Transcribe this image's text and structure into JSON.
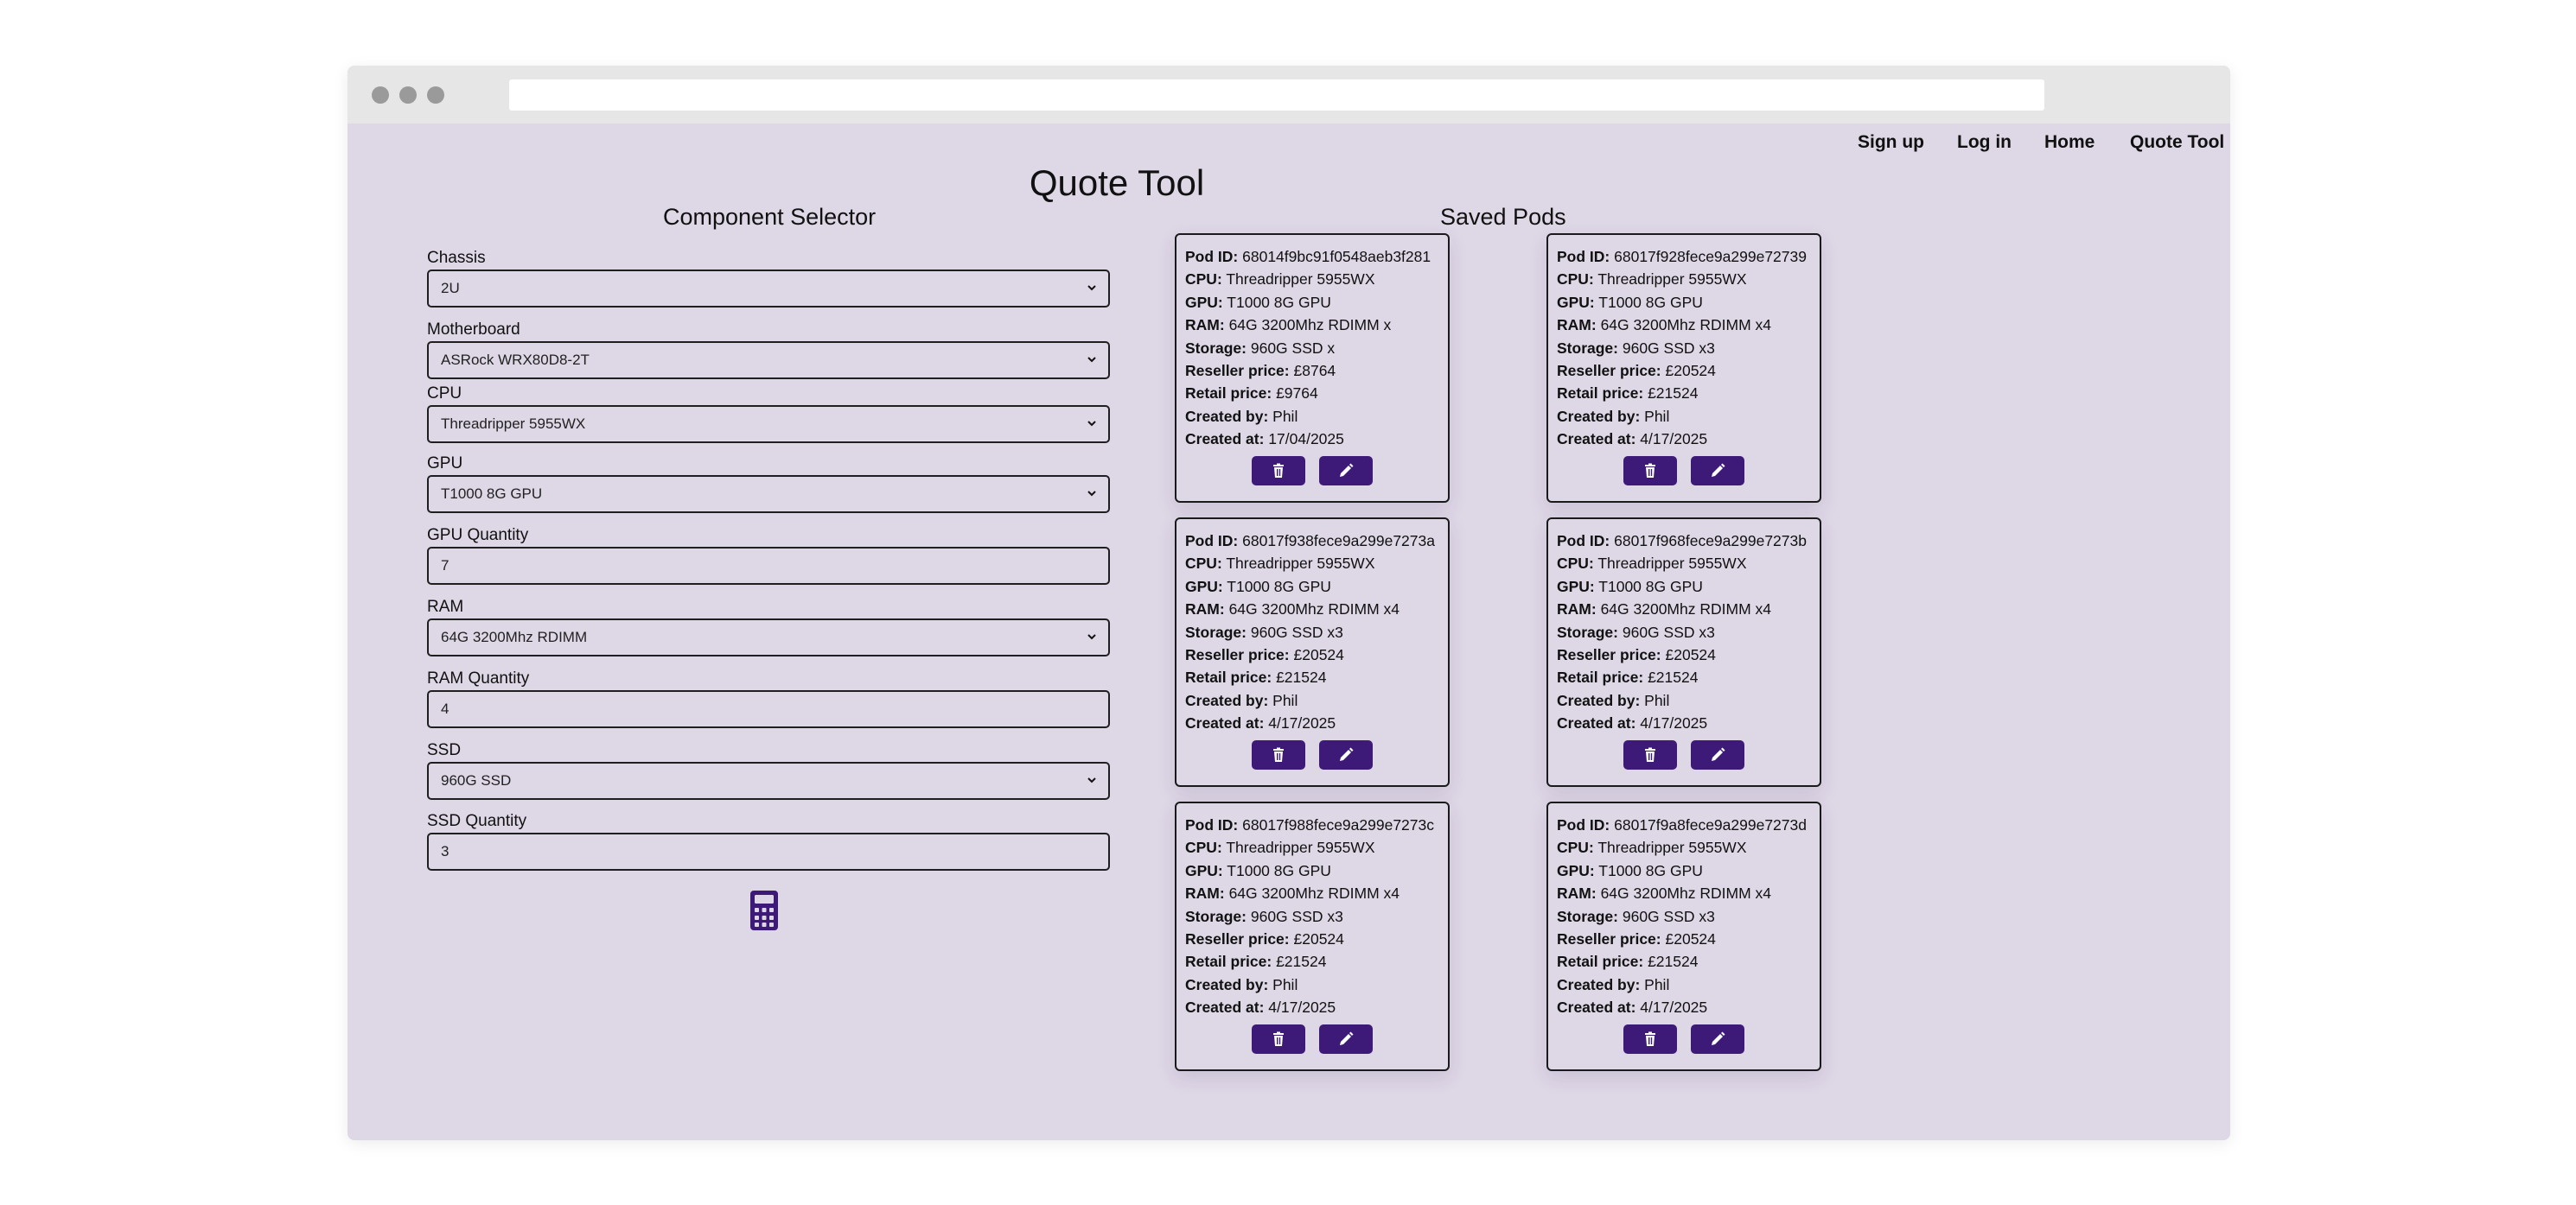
{
  "nav": [
    "Sign up",
    "Log in",
    "Home",
    "Quote Tool"
  ],
  "page_title": "Quote Tool",
  "selector": {
    "title": "Component Selector",
    "fields": [
      {
        "label": "Chassis",
        "value": "2U",
        "type": "select"
      },
      {
        "label": "Motherboard",
        "value": "ASRock WRX80D8-2T",
        "type": "select"
      },
      {
        "label": "CPU",
        "value": "Threadripper 5955WX",
        "type": "select"
      },
      {
        "label": "GPU",
        "value": "T1000 8G GPU",
        "type": "select"
      },
      {
        "label": "GPU Quantity",
        "value": "7",
        "type": "input"
      },
      {
        "label": "RAM",
        "value": "64G 3200Mhz RDIMM",
        "type": "select"
      },
      {
        "label": "RAM Quantity",
        "value": "4",
        "type": "input"
      },
      {
        "label": "SSD",
        "value": "960G SSD",
        "type": "select"
      },
      {
        "label": "SSD Quantity",
        "value": "3",
        "type": "input"
      }
    ],
    "calculate_icon": "calculator-icon"
  },
  "saved": {
    "title": "Saved Pods",
    "field_labels": [
      "Pod ID:",
      "CPU:",
      "GPU:",
      "RAM:",
      "Storage:",
      "Reseller price:",
      "Retail price:",
      "Created by:",
      "Created at:"
    ],
    "pods": [
      [
        "68014f9bc91f0548aeb3f281",
        "Threadripper 5955WX",
        "T1000 8G GPU",
        "64G 3200Mhz RDIMM x",
        "960G SSD x",
        "£8764",
        "£9764",
        "Phil",
        "17/04/2025"
      ],
      [
        "68017f928fece9a299e72739",
        "Threadripper 5955WX",
        "T1000 8G GPU",
        "64G 3200Mhz RDIMM x4",
        "960G SSD x3",
        "£20524",
        "£21524",
        "Phil",
        "4/17/2025"
      ],
      [
        "68017f938fece9a299e7273a",
        "Threadripper 5955WX",
        "T1000 8G GPU",
        "64G 3200Mhz RDIMM x4",
        "960G SSD x3",
        "£20524",
        "£21524",
        "Phil",
        "4/17/2025"
      ],
      [
        "68017f968fece9a299e7273b",
        "Threadripper 5955WX",
        "T1000 8G GPU",
        "64G 3200Mhz RDIMM x4",
        "960G SSD x3",
        "£20524",
        "£21524",
        "Phil",
        "4/17/2025"
      ],
      [
        "68017f988fece9a299e7273c",
        "Threadripper 5955WX",
        "T1000 8G GPU",
        "64G 3200Mhz RDIMM x4",
        "960G SSD x3",
        "£20524",
        "£21524",
        "Phil",
        "4/17/2025"
      ],
      [
        "68017f9a8fece9a299e7273d",
        "Threadripper 5955WX",
        "T1000 8G GPU",
        "64G 3200Mhz RDIMM x4",
        "960G SSD x3",
        "£20524",
        "£21524",
        "Phil",
        "4/17/2025"
      ]
    ],
    "buttons": {
      "delete": "trash-icon",
      "edit": "pencil-icon"
    }
  },
  "colors": {
    "background": "#ded7e6",
    "accent": "#3d1a78",
    "chrome": "#e6e6e6"
  }
}
